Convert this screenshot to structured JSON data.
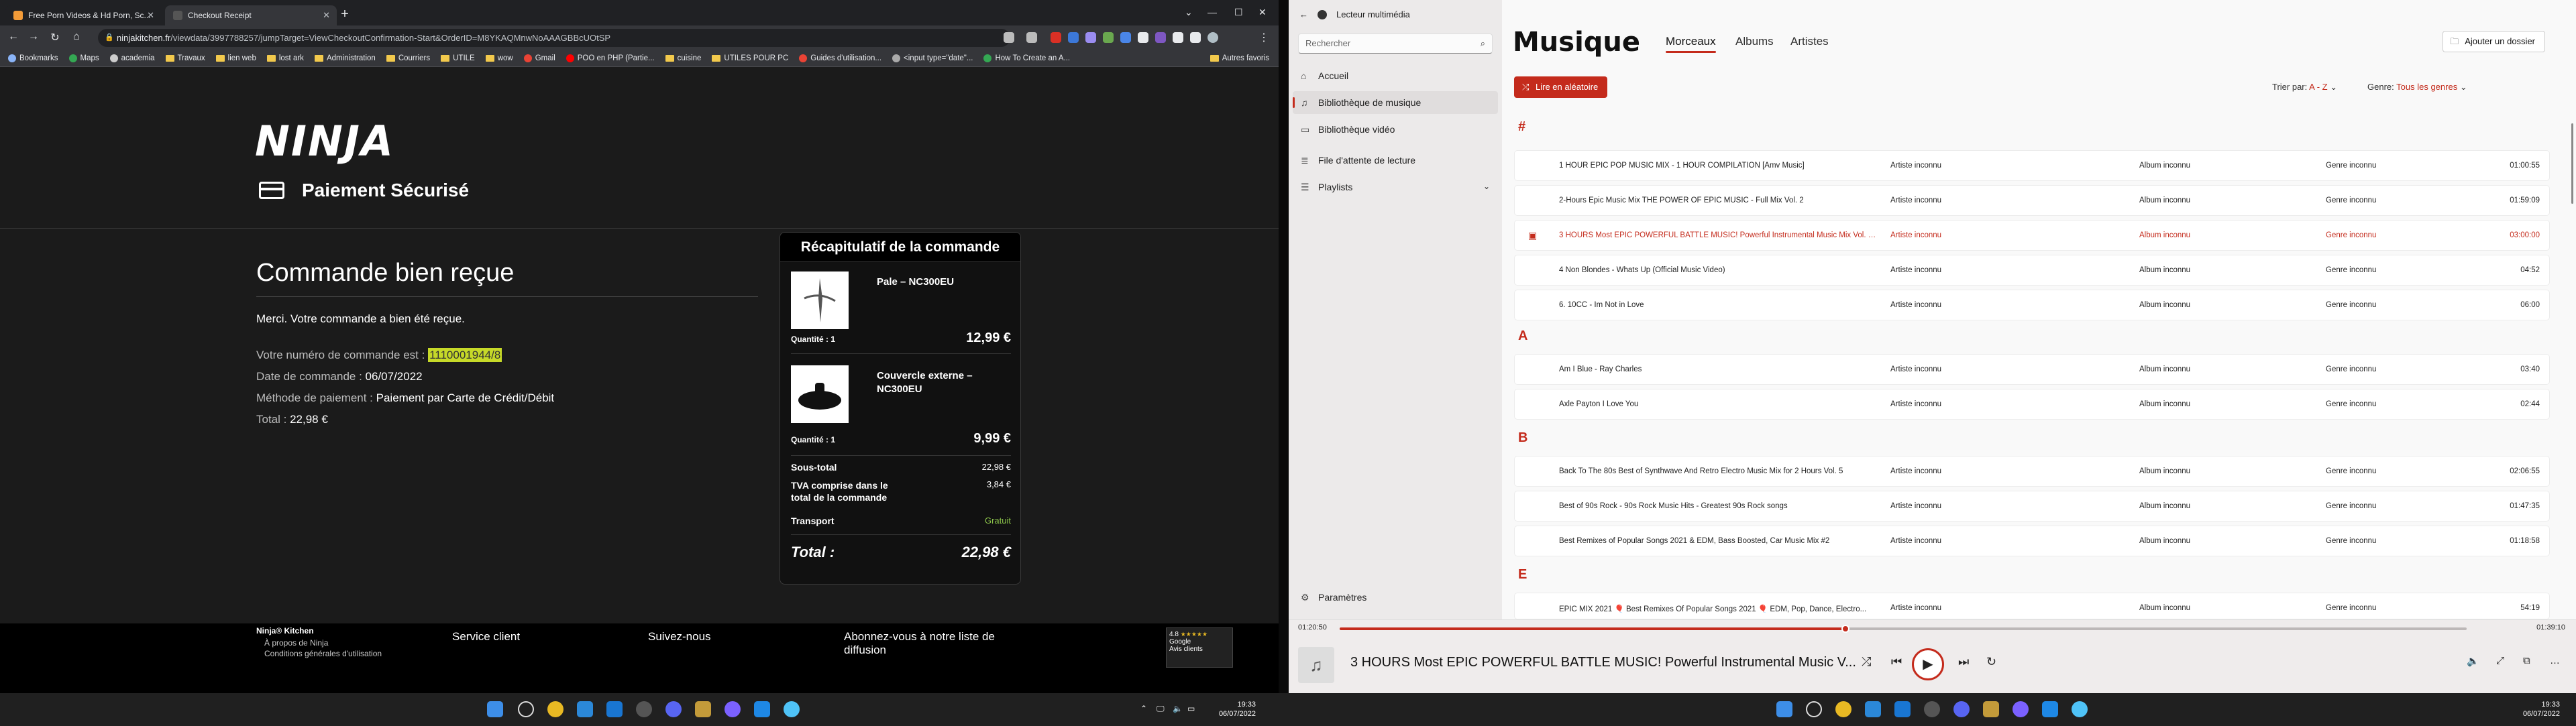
{
  "browser": {
    "tabs": [
      {
        "title": "Free Porn Videos & Hd Porn, Sc...",
        "active": false
      },
      {
        "title": "Checkout Receipt",
        "active": true
      }
    ],
    "url_host": "ninjakitchen.fr",
    "url_path": "/viewdata/3997788257/jumpTarget=ViewCheckoutConfirmation-Start&OrderID=M8YKAQMnwNoAAAGBBcUOtSP",
    "bookmarks": [
      "Bookmarks",
      "Maps",
      "academia",
      "Travaux",
      "lien web",
      "lost ark",
      "Administration",
      "Courriers",
      "UTILE",
      "wow",
      "Gmail",
      "POO en PHP (Partie...",
      "cuisine",
      "UTILES POUR PC",
      "Guides d'utilisation...",
      "<input type=\"date\"...",
      "How To Create an A...",
      "Autres favoris"
    ]
  },
  "checkout": {
    "logo": "NINJA",
    "secure_title": "Paiement Sécurisé",
    "order_title": "Commande bien reçue",
    "thanks": "Merci. Votre commande a bien été reçue.",
    "order_number_label": "Votre numéro de commande est :",
    "order_number": "1110001944/8",
    "date_label": "Date de commande :",
    "date": "06/07/2022",
    "payment_label": "Méthode de paiement :",
    "payment": "Paiement par Carte de Crédit/Débit",
    "total_label": "Total :",
    "total": "22,98 €"
  },
  "summary": {
    "heading": "Récapitulatif de la commande",
    "items": [
      {
        "name": "Pale – NC300EU",
        "qty": "Quantité : 1",
        "price": "12,99 €"
      },
      {
        "name": "Couvercle externe – NC300EU",
        "qty": "Quantité : 1",
        "price": "9,99 €"
      }
    ],
    "subtotal_label": "Sous-total",
    "subtotal": "22,98 €",
    "vat_label": "TVA comprise dans le total de la commande",
    "vat": "3,84 €",
    "shipping_label": "Transport",
    "shipping": "Gratuit",
    "total_label": "Total :",
    "total": "22,98 €"
  },
  "footer": {
    "brand": "Ninja® Kitchen",
    "links": [
      "À propos de Ninja",
      "Conditions générales d'utilisation"
    ],
    "service": "Service client",
    "follow": "Suivez-nous",
    "newsletter": "Abonnez-vous à notre liste de diffusion",
    "trust_score": "4.8",
    "trust_name": "Google",
    "trust_sub": "Avis clients"
  },
  "media": {
    "app_title": "Lecteur multimédia",
    "search_placeholder": "Rechercher",
    "nav": [
      "Accueil",
      "Bibliothèque de musique",
      "Bibliothèque vidéo",
      "File d'attente de lecture",
      "Playlists"
    ],
    "settings": "Paramètres",
    "heading": "Musique",
    "tabs": [
      "Morceaux",
      "Albums",
      "Artistes"
    ],
    "add_folder": "Ajouter un dossier",
    "shuffle": "Lire en aléatoire",
    "sort_label": "Trier par:",
    "sort_value": "A - Z",
    "genre_label": "Genre:",
    "genre_value": "Tous les genres",
    "groups": [
      {
        "letter": "#",
        "tracks": [
          {
            "title": "1 HOUR EPIC POP MUSIC MIX - 1 HOUR COMPILATION [Amv Music]",
            "artist": "Artiste inconnu",
            "album": "Album inconnu",
            "genre": "Genre inconnu",
            "duration": "01:00:55"
          },
          {
            "title": "2-Hours Epic Music Mix  THE POWER OF EPIC MUSIC - Full Mix Vol. 2",
            "artist": "Artiste inconnu",
            "album": "Album inconnu",
            "genre": "Genre inconnu",
            "duration": "01:59:09"
          },
          {
            "title": "3 HOURS Most EPIC POWERFUL BATTLE MUSIC!  Powerful Instrumental Music Mix Vol. 1  P...",
            "artist": "Artiste inconnu",
            "album": "Album inconnu",
            "genre": "Genre inconnu",
            "duration": "03:00:00",
            "playing": true
          },
          {
            "title": "4 Non Blondes - Whats Up (Official Music Video)",
            "artist": "Artiste inconnu",
            "album": "Album inconnu",
            "genre": "Genre inconnu",
            "duration": "04:52"
          },
          {
            "title": "6. 10CC - Im Not in Love",
            "artist": "Artiste inconnu",
            "album": "Album inconnu",
            "genre": "Genre inconnu",
            "duration": "06:00"
          }
        ]
      },
      {
        "letter": "A",
        "tracks": [
          {
            "title": "Am I Blue - Ray Charles",
            "artist": "Artiste inconnu",
            "album": "Album inconnu",
            "genre": "Genre inconnu",
            "duration": "03:40"
          },
          {
            "title": "Axle Payton I Love You",
            "artist": "Artiste inconnu",
            "album": "Album inconnu",
            "genre": "Genre inconnu",
            "duration": "02:44"
          }
        ]
      },
      {
        "letter": "B",
        "tracks": [
          {
            "title": "Back To The 80s  Best of Synthwave And Retro Electro Music Mix for 2 Hours  Vol. 5",
            "artist": "Artiste inconnu",
            "album": "Album inconnu",
            "genre": "Genre inconnu",
            "duration": "02:06:55"
          },
          {
            "title": "Best of 90s Rock - 90s Rock Music Hits - Greatest 90s Rock songs",
            "artist": "Artiste inconnu",
            "album": "Album inconnu",
            "genre": "Genre inconnu",
            "duration": "01:47:35"
          },
          {
            "title": "Best Remixes of Popular Songs 2021 & EDM, Bass Boosted, Car Music Mix #2",
            "artist": "Artiste inconnu",
            "album": "Album inconnu",
            "genre": "Genre inconnu",
            "duration": "01:18:58"
          }
        ]
      },
      {
        "letter": "E",
        "tracks": [
          {
            "title": "EPIC MIX 2021 🎈 Best Remixes Of Popular Songs 2021 🎈 EDM, Pop, Dance, Electro...",
            "artist": "Artiste inconnu",
            "album": "Album inconnu",
            "genre": "Genre inconnu",
            "duration": "54:19"
          }
        ]
      }
    ],
    "player": {
      "elapsed": "01:20:50",
      "remaining": "01:39:10",
      "progress": 0.4491,
      "title": "3 HOURS Most EPIC POWERFUL BATTLE MUSIC!  Powerful Instrumental Music V..."
    }
  },
  "taskbar": {
    "time": "19:33",
    "date": "06/07/2022"
  },
  "colors": {
    "accent": "#c42b1c",
    "highlight": "#c6d928",
    "shipping_green": "#8bc34a"
  }
}
